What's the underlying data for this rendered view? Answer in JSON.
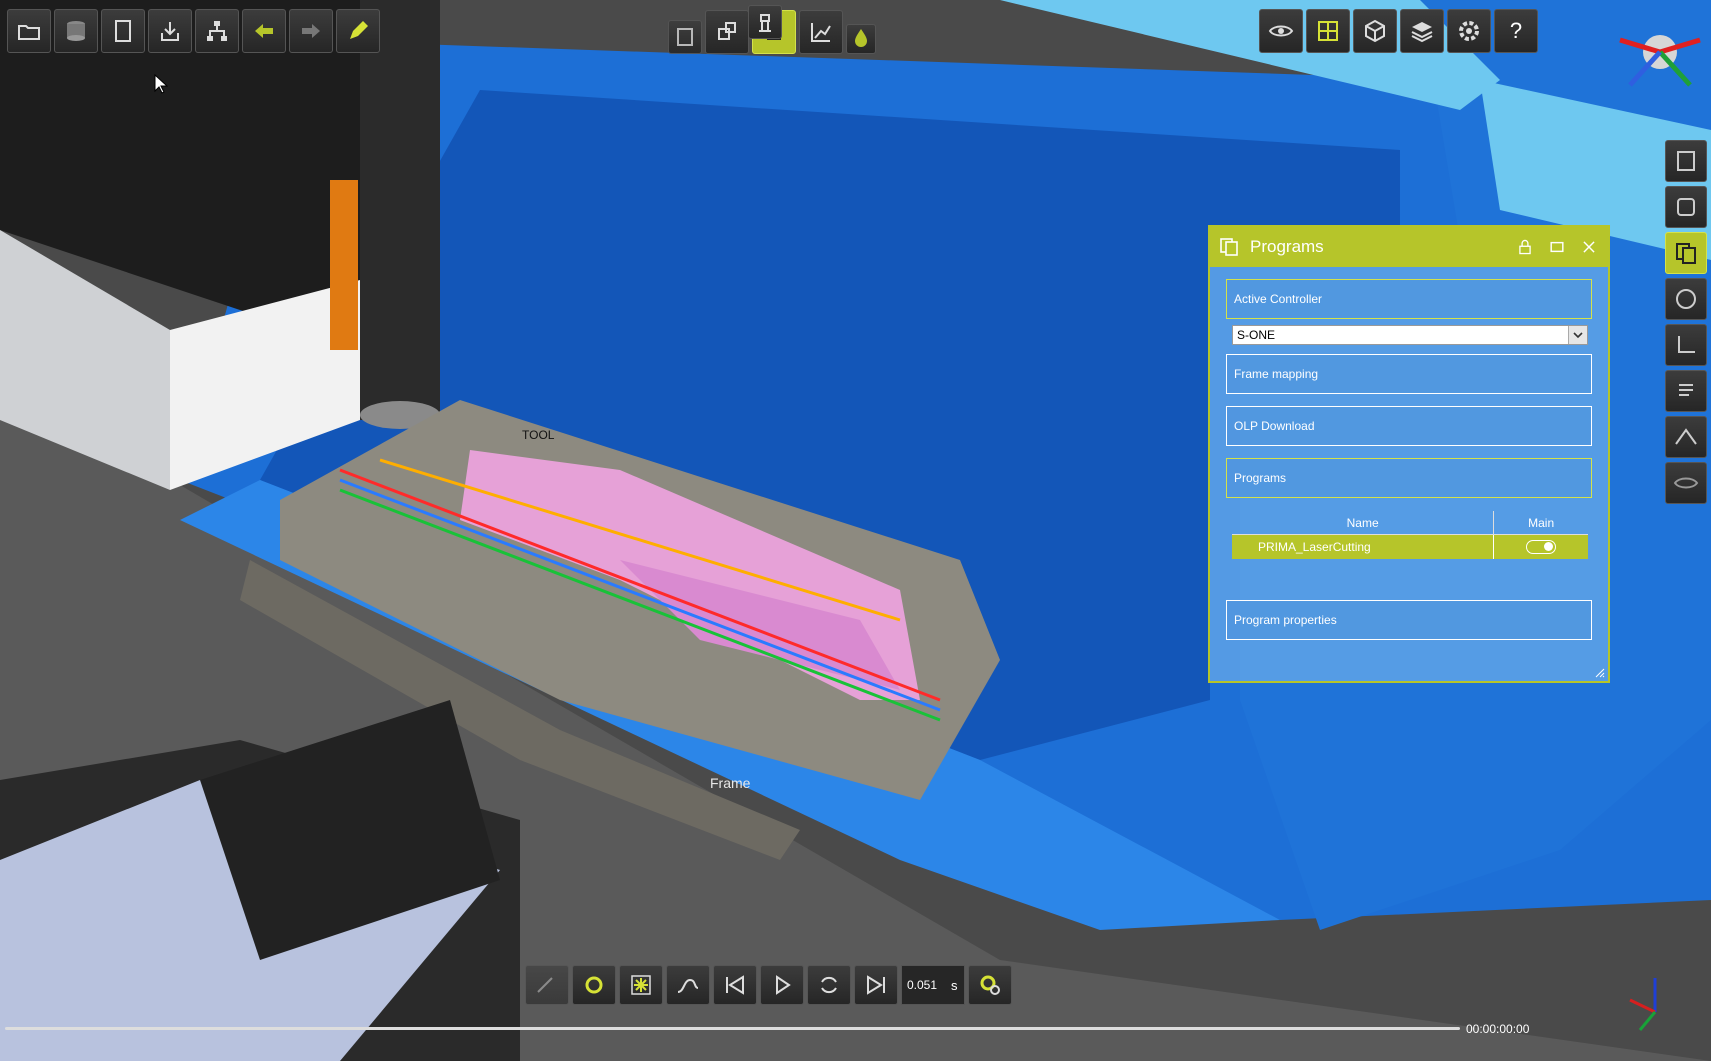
{
  "colors": {
    "accent": "#b6c52a",
    "panel_border": "#d4e24a",
    "machine_blue": "#1d6fd6"
  },
  "top_toolbar": {
    "icons": [
      "open-folder-icon",
      "database-icon",
      "notebook-icon",
      "import-icon",
      "hierarchy-icon",
      "arrow-left-icon",
      "arrow-right-icon",
      "pencil-icon"
    ]
  },
  "center_toolbar": {
    "icons": [
      "tool-path-icon",
      "station-icon",
      "robot-icon",
      "laser-cell-icon",
      "chart-icon",
      "paint-icon"
    ],
    "active": "laser-cell-icon"
  },
  "right_toolbar": {
    "icons": [
      "eye-icon",
      "grid-icon",
      "cube-icon",
      "layers-icon",
      "gear-icon",
      "help-icon"
    ],
    "help_label": "?"
  },
  "side_toolbar": {
    "icons": [
      "code-gear-icon",
      "program-edit-icon",
      "programs-icon",
      "code-icon",
      "frame-axes-icon",
      "list-icon",
      "path-icon",
      "visibility-icon"
    ],
    "active": "programs-icon"
  },
  "scene_labels": {
    "frame_label": "Frame",
    "tool_label": "TOOL"
  },
  "programs_panel": {
    "title": "Programs",
    "sections": {
      "active_controller": "Active Controller",
      "frame_mapping": "Frame mapping",
      "olp_download": "OLP Download",
      "programs": "Programs",
      "program_properties": "Program properties"
    },
    "controller_value": "S-ONE",
    "table": {
      "headers": [
        "Name",
        "Main"
      ],
      "rows": [
        {
          "name": "PRIMA_LaserCutting",
          "main": true
        }
      ]
    }
  },
  "playback": {
    "icons": [
      "path-pen-icon",
      "robot-settings-icon",
      "laser-icon",
      "trajectory-icon",
      "skip-start-icon",
      "play-icon",
      "loop-icon",
      "skip-end-icon",
      "sim-settings-icon"
    ],
    "step_value": "0.051",
    "step_unit": "s",
    "timecode": "00:00:00:00"
  }
}
